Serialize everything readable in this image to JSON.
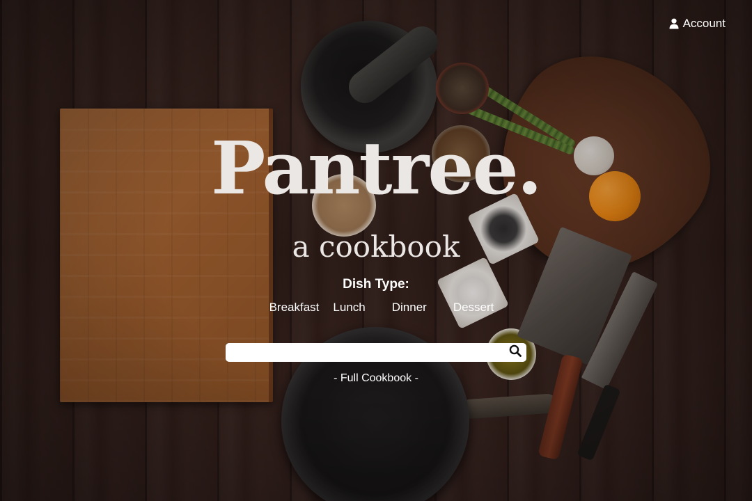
{
  "header": {
    "account_label": "Account",
    "account_icon": "user-icon"
  },
  "hero": {
    "logo_text": "Pantree.",
    "tagline": "a cookbook"
  },
  "dish_filter": {
    "heading": "Dish Type:",
    "options": [
      "Breakfast",
      "Lunch",
      "Dinner",
      "Dessert"
    ]
  },
  "search": {
    "value": "",
    "placeholder": "",
    "button_icon": "search-icon"
  },
  "footer_link": {
    "label": "- Full Cookbook -"
  },
  "colors": {
    "text": "#ffffff",
    "logo": "#ebe7e4",
    "search_bg": "#ffffff"
  }
}
